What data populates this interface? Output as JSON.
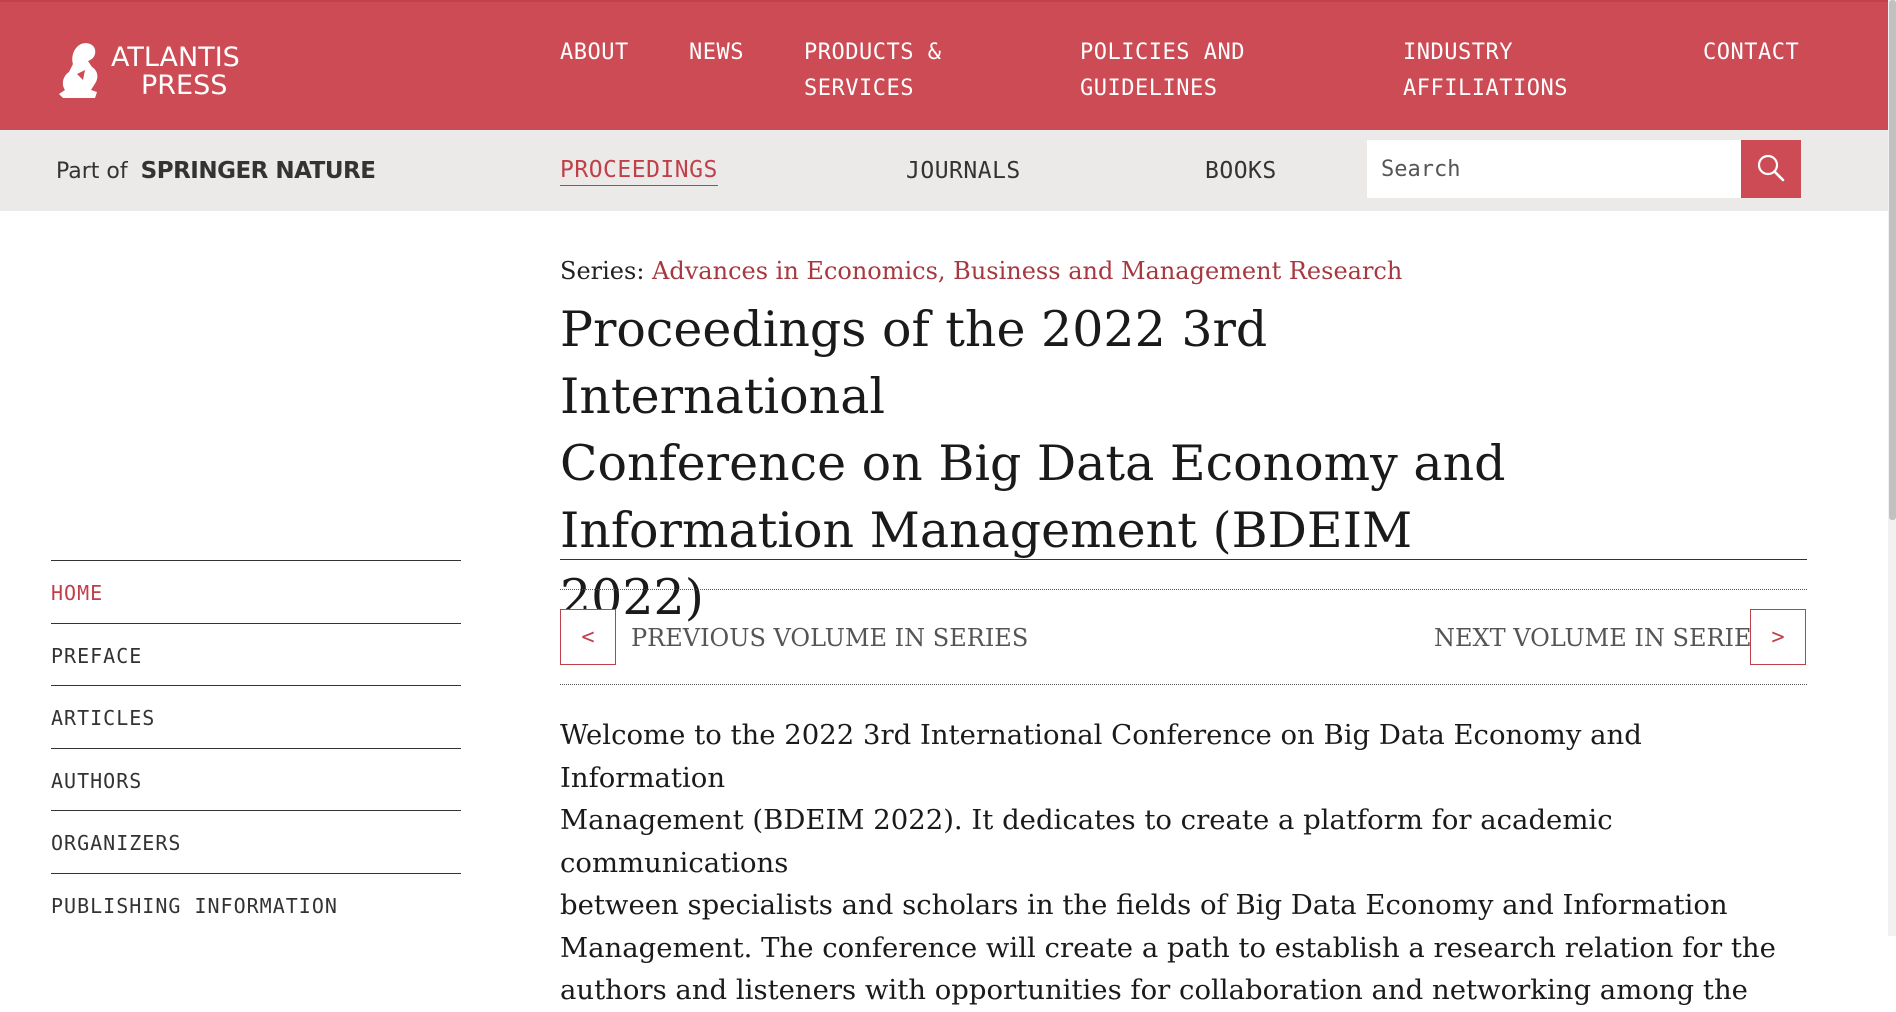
{
  "header": {
    "logo": {
      "line1": "ATLANTIS",
      "line2": "PRESS"
    },
    "nav": [
      {
        "line1": "ABOUT",
        "line2": ""
      },
      {
        "line1": "NEWS",
        "line2": ""
      },
      {
        "line1": "PRODUCTS &",
        "line2": "SERVICES"
      },
      {
        "line1": "POLICIES AND",
        "line2": "GUIDELINES"
      },
      {
        "line1": "INDUSTRY",
        "line2": "AFFILIATIONS"
      },
      {
        "line1": "CONTACT",
        "line2": ""
      }
    ],
    "brand_color": "#cc4b55"
  },
  "subheader": {
    "part_of": "Part of",
    "springer": "SPRINGER NATURE",
    "tabs": [
      "PROCEEDINGS",
      "JOURNALS",
      "BOOKS"
    ],
    "active_tab": "PROCEEDINGS",
    "search": {
      "placeholder": "Search",
      "value": ""
    }
  },
  "main": {
    "series_label": "Series:",
    "series_link": "Advances in Economics, Business and Management Research",
    "title_lines": [
      "Proceedings of the 2022 3rd International",
      "Conference on Big Data Economy and",
      "Information Management (BDEIM 2022)"
    ],
    "prev_label": "PREVIOUS VOLUME IN SERIES",
    "next_label": "NEXT VOLUME IN SERIES",
    "prev_glyph": "<",
    "next_glyph": ">",
    "intro_lines": [
      "Welcome to the 2022 3rd International Conference on Big Data Economy and Information",
      "Management (BDEIM 2022). It dedicates to create a platform for academic communications",
      "between specialists and scholars in the fields of Big Data Economy and Information",
      "Management. The conference will create a path to establish a research relation for the",
      "authors and listeners with opportunities for collaboration and networking among the"
    ]
  },
  "sidebar": {
    "items": [
      "HOME",
      "PREFACE",
      "ARTICLES",
      "AUTHORS",
      "ORGANIZERS",
      "PUBLISHING INFORMATION"
    ],
    "active": "HOME"
  }
}
